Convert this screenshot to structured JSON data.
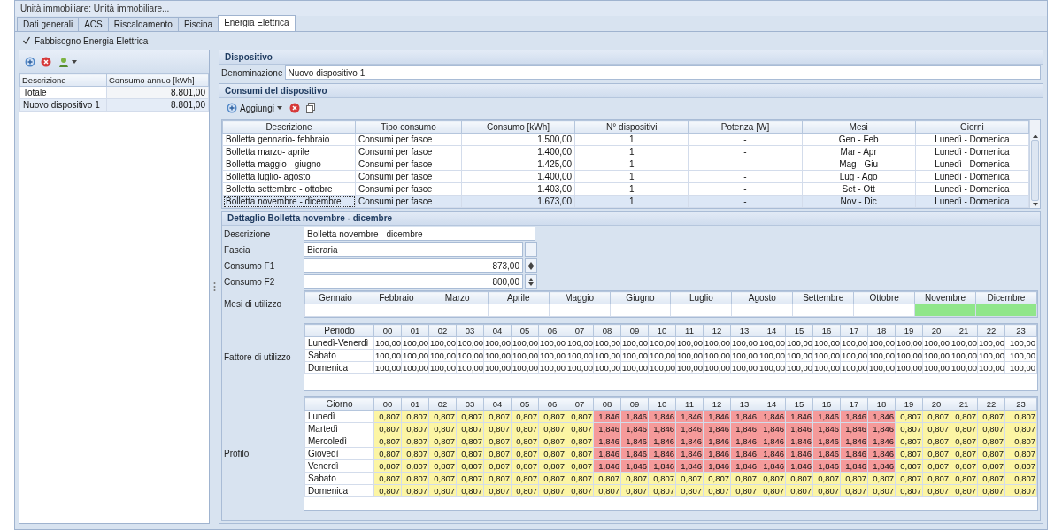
{
  "window": {
    "title": "Unità immobiliare: Unità immobiliare..."
  },
  "tabs": [
    {
      "label": "Dati generali",
      "selected": false
    },
    {
      "label": "ACS",
      "selected": false
    },
    {
      "label": "Riscaldamento",
      "selected": false
    },
    {
      "label": "Piscina",
      "selected": false
    },
    {
      "label": "Energia Elettrica",
      "selected": true
    }
  ],
  "requirement_checkbox": {
    "label": "Fabbisogno Energia Elettrica",
    "checked": true
  },
  "device_list": {
    "columns": [
      "Descrizione",
      "Consumo annuo [kWh]"
    ],
    "rows": [
      {
        "name": "Totale",
        "value": "8.801,00",
        "selected": false
      },
      {
        "name": "Nuovo dispositivo 1",
        "value": "8.801,00",
        "selected": true
      }
    ]
  },
  "device": {
    "title": "Dispositivo",
    "name_label": "Denominazione",
    "name_value": "Nuovo dispositivo 1"
  },
  "consumptions": {
    "title": "Consumi del dispositivo",
    "add_button": "Aggiungi",
    "columns": [
      "Descrizione",
      "Tipo consumo",
      "Consumo [kWh]",
      "N° dispositivi",
      "Potenza [W]",
      "Mesi",
      "Giorni"
    ],
    "rows": [
      {
        "cells": [
          "Bolletta gennario- febbraio",
          "Consumi per fasce",
          "1.500,00",
          "1",
          "-",
          "Gen - Feb",
          "Lunedì - Domenica"
        ],
        "selected": false
      },
      {
        "cells": [
          "Bolletta marzo- aprile",
          "Consumi per fasce",
          "1.400,00",
          "1",
          "-",
          "Mar - Apr",
          "Lunedì - Domenica"
        ],
        "selected": false
      },
      {
        "cells": [
          "Bolletta maggio - giugno",
          "Consumi per fasce",
          "1.425,00",
          "1",
          "-",
          "Mag - Giu",
          "Lunedì - Domenica"
        ],
        "selected": false
      },
      {
        "cells": [
          "Bolletta luglio- agosto",
          "Consumi per fasce",
          "1.400,00",
          "1",
          "-",
          "Lug - Ago",
          "Lunedì - Domenica"
        ],
        "selected": false
      },
      {
        "cells": [
          "Bolletta settembre - ottobre",
          "Consumi per fasce",
          "1.403,00",
          "1",
          "-",
          "Set - Ott",
          "Lunedì - Domenica"
        ],
        "selected": false
      },
      {
        "cells": [
          "Bolletta novembre - dicembre",
          "Consumi per fasce",
          "1.673,00",
          "1",
          "-",
          "Nov - Dic",
          "Lunedì - Domenica"
        ],
        "selected": true
      }
    ]
  },
  "detail": {
    "title": "Dettaglio Bolletta novembre - dicembre",
    "fields": [
      {
        "kind": "text",
        "label": "Descrizione",
        "value": "Bolletta novembre - dicembre"
      },
      {
        "kind": "picker",
        "label": "Fascia",
        "value": "Bioraria",
        "button": "···"
      },
      {
        "kind": "spin",
        "label": "Consumo F1",
        "value": "873,00"
      },
      {
        "kind": "spin",
        "label": "Consumo F2",
        "value": "800,00"
      }
    ]
  },
  "months": {
    "label": "Mesi di utilizzo",
    "items": [
      {
        "name": "Gennaio",
        "selected": false
      },
      {
        "name": "Febbraio",
        "selected": false
      },
      {
        "name": "Marzo",
        "selected": false
      },
      {
        "name": "Aprile",
        "selected": false
      },
      {
        "name": "Maggio",
        "selected": false
      },
      {
        "name": "Giugno",
        "selected": false
      },
      {
        "name": "Luglio",
        "selected": false
      },
      {
        "name": "Agosto",
        "selected": false
      },
      {
        "name": "Settembre",
        "selected": false
      },
      {
        "name": "Ottobre",
        "selected": false
      },
      {
        "name": "Novembre",
        "selected": true
      },
      {
        "name": "Dicembre",
        "selected": true
      }
    ]
  },
  "usage_factor": {
    "label": "Fattore di utilizzo",
    "header": "Periodo",
    "hours": [
      "00",
      "01",
      "02",
      "03",
      "04",
      "05",
      "06",
      "07",
      "08",
      "09",
      "10",
      "11",
      "12",
      "13",
      "14",
      "15",
      "16",
      "17",
      "18",
      "19",
      "20",
      "21",
      "22",
      "23"
    ],
    "rows": [
      {
        "name": "Lunedì-Venerdì",
        "values": [
          "100,00",
          "100,00",
          "100,00",
          "100,00",
          "100,00",
          "100,00",
          "100,00",
          "100,00",
          "100,00",
          "100,00",
          "100,00",
          "100,00",
          "100,00",
          "100,00",
          "100,00",
          "100,00",
          "100,00",
          "100,00",
          "100,00",
          "100,00",
          "100,00",
          "100,00",
          "100,00",
          "100,00"
        ]
      },
      {
        "name": "Sabato",
        "values": [
          "100,00",
          "100,00",
          "100,00",
          "100,00",
          "100,00",
          "100,00",
          "100,00",
          "100,00",
          "100,00",
          "100,00",
          "100,00",
          "100,00",
          "100,00",
          "100,00",
          "100,00",
          "100,00",
          "100,00",
          "100,00",
          "100,00",
          "100,00",
          "100,00",
          "100,00",
          "100,00",
          "100,00"
        ]
      },
      {
        "name": "Domenica",
        "values": [
          "100,00",
          "100,00",
          "100,00",
          "100,00",
          "100,00",
          "100,00",
          "100,00",
          "100,00",
          "100,00",
          "100,00",
          "100,00",
          "100,00",
          "100,00",
          "100,00",
          "100,00",
          "100,00",
          "100,00",
          "100,00",
          "100,00",
          "100,00",
          "100,00",
          "100,00",
          "100,00",
          "100,00"
        ]
      }
    ]
  },
  "profile": {
    "label": "Profilo",
    "header": "Giorno",
    "hours": [
      "00",
      "01",
      "02",
      "03",
      "04",
      "05",
      "06",
      "07",
      "08",
      "09",
      "10",
      "11",
      "12",
      "13",
      "14",
      "15",
      "16",
      "17",
      "18",
      "19",
      "20",
      "21",
      "22",
      "23"
    ],
    "rows": [
      {
        "name": "Lunedì",
        "values": [
          "0,807",
          "0,807",
          "0,807",
          "0,807",
          "0,807",
          "0,807",
          "0,807",
          "0,807",
          "1,846",
          "1,846",
          "1,846",
          "1,846",
          "1,846",
          "1,846",
          "1,846",
          "1,846",
          "1,846",
          "1,846",
          "1,846",
          "0,807",
          "0,807",
          "0,807",
          "0,807",
          "0,807"
        ],
        "peak": [
          false,
          false,
          false,
          false,
          false,
          false,
          false,
          false,
          true,
          true,
          true,
          true,
          true,
          true,
          true,
          true,
          true,
          true,
          true,
          false,
          false,
          false,
          false,
          false
        ]
      },
      {
        "name": "Martedì",
        "values": [
          "0,807",
          "0,807",
          "0,807",
          "0,807",
          "0,807",
          "0,807",
          "0,807",
          "0,807",
          "1,846",
          "1,846",
          "1,846",
          "1,846",
          "1,846",
          "1,846",
          "1,846",
          "1,846",
          "1,846",
          "1,846",
          "1,846",
          "0,807",
          "0,807",
          "0,807",
          "0,807",
          "0,807"
        ],
        "peak": [
          false,
          false,
          false,
          false,
          false,
          false,
          false,
          false,
          true,
          true,
          true,
          true,
          true,
          true,
          true,
          true,
          true,
          true,
          true,
          false,
          false,
          false,
          false,
          false
        ]
      },
      {
        "name": "Mercoledì",
        "values": [
          "0,807",
          "0,807",
          "0,807",
          "0,807",
          "0,807",
          "0,807",
          "0,807",
          "0,807",
          "1,846",
          "1,846",
          "1,846",
          "1,846",
          "1,846",
          "1,846",
          "1,846",
          "1,846",
          "1,846",
          "1,846",
          "1,846",
          "0,807",
          "0,807",
          "0,807",
          "0,807",
          "0,807"
        ],
        "peak": [
          false,
          false,
          false,
          false,
          false,
          false,
          false,
          false,
          true,
          true,
          true,
          true,
          true,
          true,
          true,
          true,
          true,
          true,
          true,
          false,
          false,
          false,
          false,
          false
        ]
      },
      {
        "name": "Giovedì",
        "values": [
          "0,807",
          "0,807",
          "0,807",
          "0,807",
          "0,807",
          "0,807",
          "0,807",
          "0,807",
          "1,846",
          "1,846",
          "1,846",
          "1,846",
          "1,846",
          "1,846",
          "1,846",
          "1,846",
          "1,846",
          "1,846",
          "1,846",
          "0,807",
          "0,807",
          "0,807",
          "0,807",
          "0,807"
        ],
        "peak": [
          false,
          false,
          false,
          false,
          false,
          false,
          false,
          false,
          true,
          true,
          true,
          true,
          true,
          true,
          true,
          true,
          true,
          true,
          true,
          false,
          false,
          false,
          false,
          false
        ]
      },
      {
        "name": "Venerdì",
        "values": [
          "0,807",
          "0,807",
          "0,807",
          "0,807",
          "0,807",
          "0,807",
          "0,807",
          "0,807",
          "1,846",
          "1,846",
          "1,846",
          "1,846",
          "1,846",
          "1,846",
          "1,846",
          "1,846",
          "1,846",
          "1,846",
          "1,846",
          "0,807",
          "0,807",
          "0,807",
          "0,807",
          "0,807"
        ],
        "peak": [
          false,
          false,
          false,
          false,
          false,
          false,
          false,
          false,
          true,
          true,
          true,
          true,
          true,
          true,
          true,
          true,
          true,
          true,
          true,
          false,
          false,
          false,
          false,
          false
        ]
      },
      {
        "name": "Sabato",
        "values": [
          "0,807",
          "0,807",
          "0,807",
          "0,807",
          "0,807",
          "0,807",
          "0,807",
          "0,807",
          "0,807",
          "0,807",
          "0,807",
          "0,807",
          "0,807",
          "0,807",
          "0,807",
          "0,807",
          "0,807",
          "0,807",
          "0,807",
          "0,807",
          "0,807",
          "0,807",
          "0,807",
          "0,807"
        ],
        "peak": [
          false,
          false,
          false,
          false,
          false,
          false,
          false,
          false,
          false,
          false,
          false,
          false,
          false,
          false,
          false,
          false,
          false,
          false,
          false,
          false,
          false,
          false,
          false,
          false
        ]
      },
      {
        "name": "Domenica",
        "values": [
          "0,807",
          "0,807",
          "0,807",
          "0,807",
          "0,807",
          "0,807",
          "0,807",
          "0,807",
          "0,807",
          "0,807",
          "0,807",
          "0,807",
          "0,807",
          "0,807",
          "0,807",
          "0,807",
          "0,807",
          "0,807",
          "0,807",
          "0,807",
          "0,807",
          "0,807",
          "0,807",
          "0,807"
        ],
        "peak": [
          false,
          false,
          false,
          false,
          false,
          false,
          false,
          false,
          false,
          false,
          false,
          false,
          false,
          false,
          false,
          false,
          false,
          false,
          false,
          false,
          false,
          false,
          false,
          false
        ]
      }
    ]
  }
}
